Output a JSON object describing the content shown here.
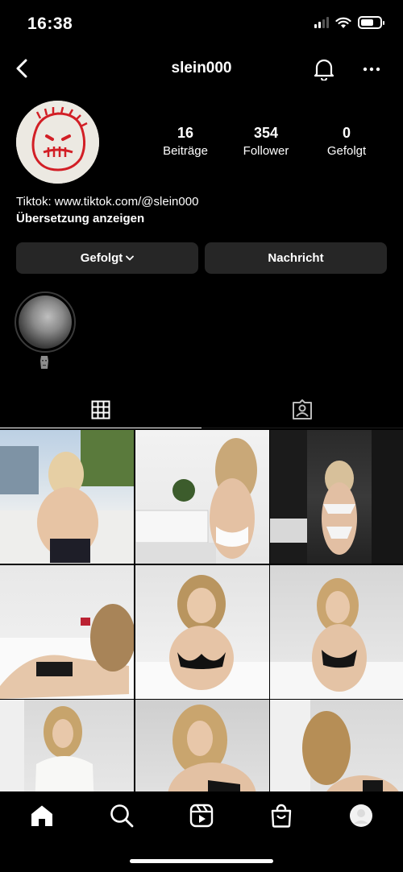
{
  "status_bar": {
    "time": "16:38"
  },
  "header": {
    "username": "slein000"
  },
  "profile": {
    "stats": [
      {
        "count": "16",
        "label": "Beiträge"
      },
      {
        "count": "354",
        "label": "Follower"
      },
      {
        "count": "0",
        "label": "Gefolgt"
      }
    ],
    "bio_line": "Tiktok: www.tiktok.com/@slein000",
    "translate_label": "Übersetzung anzeigen"
  },
  "actions": {
    "following_label": "Gefolgt",
    "message_label": "Nachricht"
  },
  "tabs": [
    {
      "icon": "grid-icon",
      "active": true
    },
    {
      "icon": "tagged-icon",
      "active": false
    }
  ],
  "bottom_nav": [
    "home-icon",
    "search-icon",
    "reels-icon",
    "shop-icon",
    "profile-avatar"
  ],
  "colors": {
    "background": "#000000",
    "button": "#262626",
    "avatar_red": "#d21f26"
  }
}
